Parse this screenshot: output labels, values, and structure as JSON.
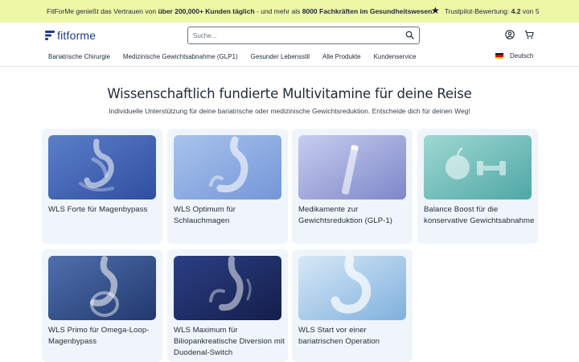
{
  "announcement": {
    "text_1": "FitForMe genießt das Vertrauen von ",
    "bold_1": "über 200,000+ Kunden täglich",
    "text_2": " - und mehr als ",
    "bold_2": "8000 Fachkräften im Gesundheitswesen.",
    "trust_label": "Trustpilot-Bewertung: ",
    "trust_score": "4.2",
    "trust_suffix": " von 5"
  },
  "header": {
    "logo_text": "fitforme",
    "search_placeholder": "Suche...",
    "icons": [
      "search-icon",
      "account-icon",
      "cart-icon"
    ],
    "nav": [
      "Bariatrische Chirurgie",
      "Medizinische Gewichtsabnahme (GLP1)",
      "Gesunder Lebensstil",
      "Alle Produkte",
      "Kundenservice"
    ],
    "language": "Deutsch"
  },
  "main": {
    "title": "Wissenschaftlich fundierte Multivitamine für deine Reise",
    "subtitle": "Individuelle Unterstützung für deine bariatrische oder medizinische Gewichtsreduktion. Entscheide dich für deinen Weg!",
    "cards": [
      {
        "label": "WLS Forte für Magenbypass",
        "icon": "gastric-bypass-illustration"
      },
      {
        "label": "WLS Optimum für Schlauchmagen",
        "icon": "sleeve-stomach-illustration"
      },
      {
        "label": "Medikamente zur Gewichtsreduktion (GLP-1)",
        "icon": "injection-pen-illustration"
      },
      {
        "label": "Balance Boost für die konservative Gewichtsabnahme",
        "icon": "apple-dumbbell-illustration"
      },
      {
        "label": "WLS Primo für Omega-Loop-Magenbypass",
        "icon": "omega-loop-illustration"
      },
      {
        "label": "WLS Maximum für Biliopankreatische Diversion mit Duodenal-Switch",
        "icon": "duodenal-switch-illustration"
      },
      {
        "label": "WLS Start vor einer bariatrischen Operation",
        "icon": "stomach-illustration"
      }
    ]
  },
  "colors": {
    "announcement_bg": "#eef7a6",
    "brand": "#1e3a8a",
    "card_bg": "#f0f5fb"
  }
}
